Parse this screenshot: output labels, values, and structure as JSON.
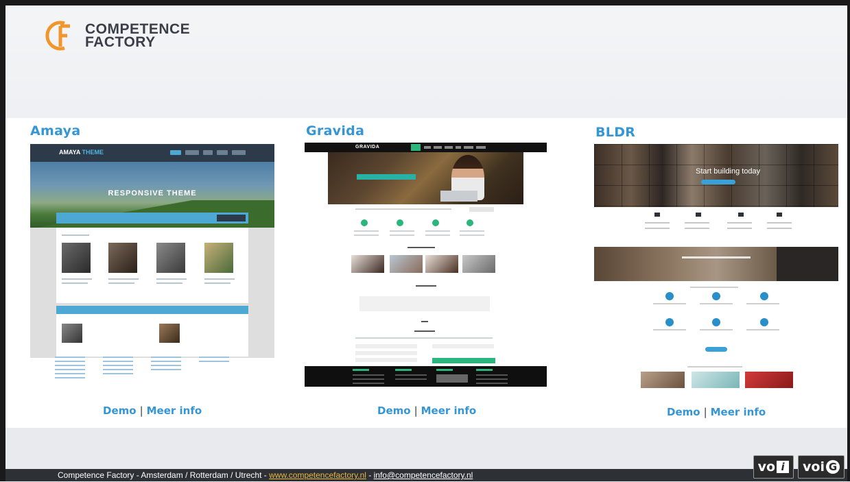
{
  "logo": {
    "line1": "COMPETENCE",
    "line2": "FACTORY"
  },
  "themes": [
    {
      "title": "Amaya",
      "demo": "Demo",
      "separator": "|",
      "info": "Meer info",
      "preview": {
        "brand": "AMAYA",
        "brand_accent": "THEME",
        "hero": "RESPONSIVE THEME"
      }
    },
    {
      "title": "Gravida",
      "demo": "Demo",
      "separator": "|",
      "info": "Meer info",
      "preview": {
        "brand": "GRAVIDA"
      }
    },
    {
      "title": "BLDR",
      "demo": "Demo",
      "separator": "|",
      "info": "Meer info",
      "preview": {
        "hero": "Start building today"
      }
    }
  ],
  "footer": {
    "text": "Competence Factory -  Amsterdam / Rotterdam / Utrecht - ",
    "website": "www.competencefactory.nl",
    "dash": " - ",
    "email": "info@competencefactory.nl"
  },
  "badges": {
    "voi1": "vo",
    "voi1_box": "i",
    "voi2": "voi",
    "voi2_circle": "G"
  },
  "colors": {
    "accent": "#3596d6",
    "logo_orange": "#f0962d",
    "footer_bg": "#2d3035",
    "link_yellow": "#e8b53f"
  }
}
